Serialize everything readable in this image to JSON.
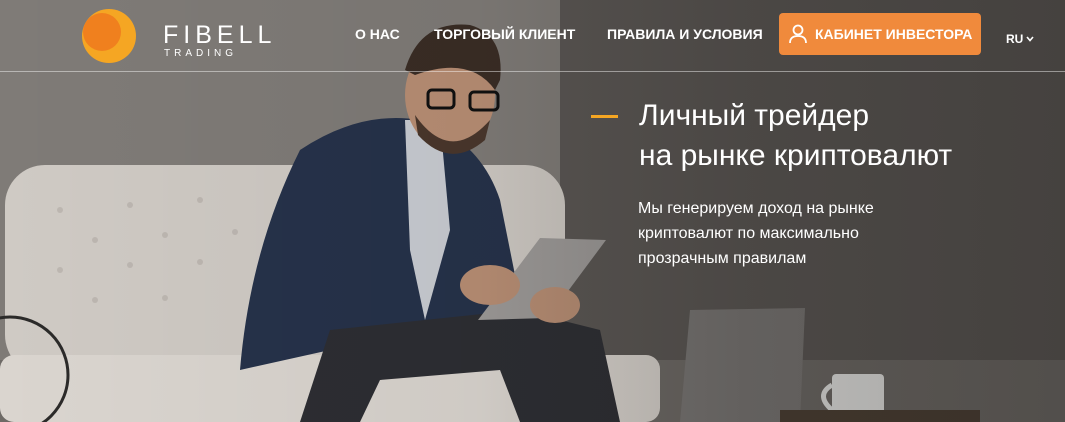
{
  "brand": {
    "name": "FIBELL",
    "sub": "TRADING",
    "primary_color": "#f5a623",
    "secondary_color": "#f08a3c"
  },
  "nav": {
    "items": [
      {
        "label": "О НАС"
      },
      {
        "label": "ТОРГОВЫЙ КЛИЕНТ"
      },
      {
        "label": "ПРАВИЛА И УСЛОВИЯ"
      }
    ],
    "cta": {
      "label": "КАБИНЕТ ИНВЕСТОРА",
      "icon": "user-icon",
      "color": "#f08a3c"
    },
    "lang": {
      "label": "RU",
      "icon": "chevron-down-icon"
    }
  },
  "hero": {
    "title_lines": [
      "Личный трейдер",
      "на рынке криптовалют"
    ],
    "subtitle_lines": [
      "Мы генерируем доход на рынке",
      "криптовалют по максимально",
      "прозрачным правилам"
    ],
    "accent_color": "#f5a623",
    "image": "man-with-tablet-on-sofa"
  }
}
